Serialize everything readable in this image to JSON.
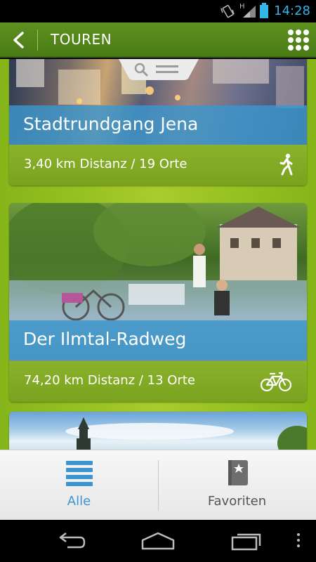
{
  "status_bar": {
    "time": "14:28",
    "network_letter": "H",
    "icons": [
      "vibrate-icon",
      "signal-icon",
      "battery-icon"
    ]
  },
  "action_bar": {
    "title": "TOUREN",
    "back_icon": "chevron-left-icon",
    "menu_icon": "grid-menu-icon"
  },
  "tours": [
    {
      "title": "Stadtrundgang Jena",
      "distance": "3,40 km Distanz / 19 Orte",
      "mode": "walking-icon"
    },
    {
      "title": "Der Ilmtal-Radweg",
      "distance": "74,20 km Distanz / 13 Orte",
      "mode": "bicycle-icon"
    },
    {
      "title": "",
      "distance": "",
      "mode": ""
    }
  ],
  "bottom_nav": {
    "items": [
      {
        "label": "Alle",
        "icon": "list-icon",
        "active": true
      },
      {
        "label": "Favoriten",
        "icon": "bookmark-star-icon",
        "active": false
      }
    ]
  },
  "colors": {
    "action_bar": "#4a7c16",
    "content_bg": "#a8cc2b",
    "title_band": "#3c96cd",
    "active_tab": "#3a95d0"
  }
}
